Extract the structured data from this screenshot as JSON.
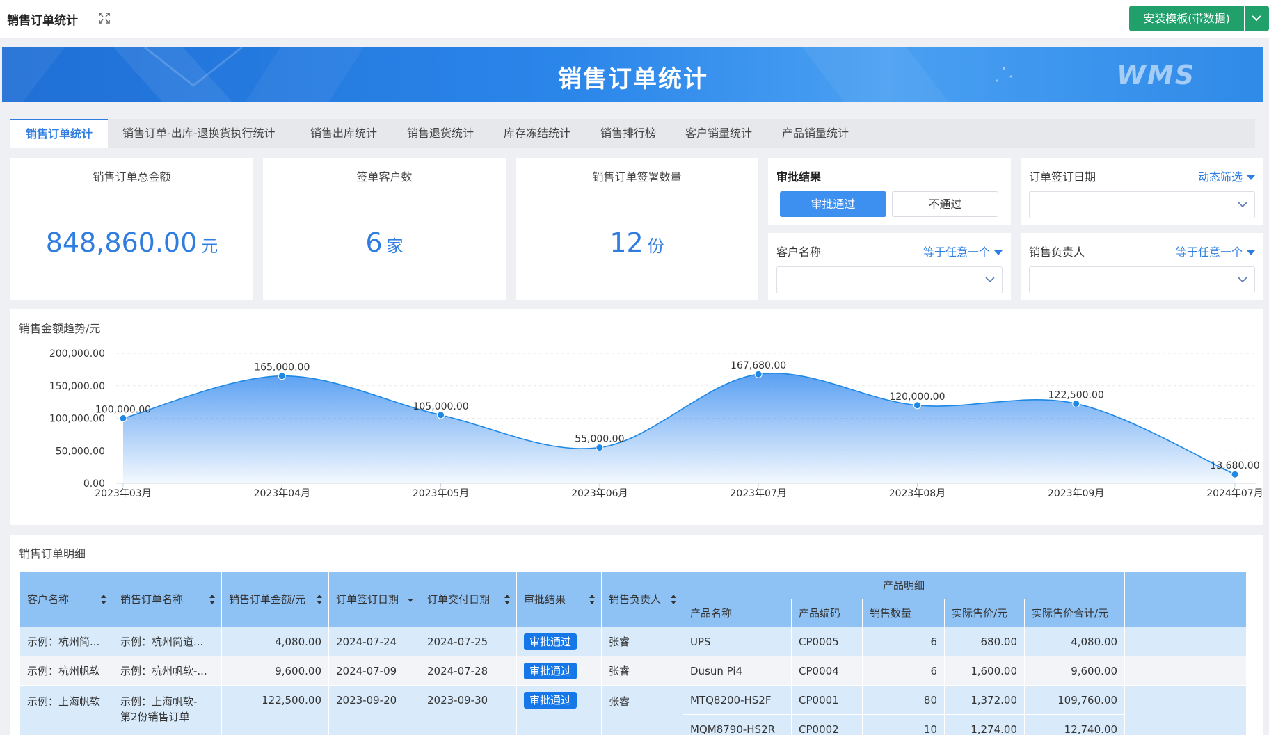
{
  "top": {
    "title": "销售订单统计",
    "install_label": "安装模板(带数据)"
  },
  "banner": {
    "title": "销售订单统计",
    "logo": "WMS"
  },
  "tabs": [
    {
      "label": "销售订单统计",
      "active": true
    },
    {
      "label": "销售订单-出库-退换货执行统计"
    },
    {
      "label": "销售出库统计"
    },
    {
      "label": "销售退货统计"
    },
    {
      "label": "库存冻结统计"
    },
    {
      "label": "销售排行榜"
    },
    {
      "label": "客户销量统计"
    },
    {
      "label": "产品销量统计"
    }
  ],
  "kpis": [
    {
      "label": "销售订单总金额",
      "value": "848,860.00",
      "unit": "元"
    },
    {
      "label": "签单客户数",
      "value": "6",
      "unit": "家"
    },
    {
      "label": "销售订单签署数量",
      "value": "12",
      "unit": "份"
    }
  ],
  "filters": {
    "approval": {
      "label": "审批结果",
      "options": [
        "审批通过",
        "不通过"
      ],
      "selected": "审批通过"
    },
    "sign_date": {
      "label": "订单签订日期",
      "mode": "动态筛选"
    },
    "customer": {
      "label": "客户名称",
      "mode": "等于任意一个"
    },
    "owner": {
      "label": "销售负责人",
      "mode": "等于任意一个"
    }
  },
  "chart_data": {
    "type": "area",
    "title": "销售金额趋势/元",
    "categories": [
      "2023年03月",
      "2023年04月",
      "2023年05月",
      "2023年06月",
      "2023年07月",
      "2023年08月",
      "2023年09月",
      "2024年07月"
    ],
    "values": [
      100000,
      165000,
      105000,
      55000,
      167680,
      120000,
      122500,
      13680
    ],
    "value_labels": [
      "100,000.00",
      "165,000.00",
      "105,000.00",
      "55,000.00",
      "167,680.00",
      "120,000.00",
      "122,500.00",
      "13,680.00"
    ],
    "y_ticks": [
      "0.00",
      "50,000.00",
      "100,000.00",
      "150,000.00",
      "200,000.00"
    ],
    "ylim": [
      0,
      200000
    ],
    "grid": true,
    "color": "#1e88e5"
  },
  "table": {
    "title": "销售订单明细",
    "headers": [
      "客户名称",
      "销售订单名称",
      "销售订单金额/元",
      "订单签订日期",
      "订单交付日期",
      "审批结果",
      "销售负责人"
    ],
    "group_header": "产品明细",
    "sub_headers": [
      "产品名称",
      "产品编码",
      "销售数量",
      "实际售价/元",
      "实际售价合计/元"
    ],
    "rows": [
      {
        "customer": "示例：杭州简...",
        "order": "示例：杭州简道...",
        "amount": "4,080.00",
        "sign": "2024-07-24",
        "deliver": "2024-07-25",
        "approval": "审批通过",
        "owner": "张睿",
        "product": "UPS",
        "code": "CP0005",
        "qty": "6",
        "price": "680.00",
        "total": "4,080.00"
      },
      {
        "customer": "示例：杭州帆软",
        "order": "示例：杭州帆软-...",
        "amount": "9,600.00",
        "sign": "2024-07-09",
        "deliver": "2024-07-28",
        "approval": "审批通过",
        "owner": "张睿",
        "product": "Dusun Pi4",
        "code": "CP0004",
        "qty": "6",
        "price": "1,600.00",
        "total": "9,600.00"
      },
      {
        "customer": "示例：上海帆软",
        "order_line1": "示例：上海帆软-",
        "order_line2": "第2份销售订单",
        "amount": "122,500.00",
        "sign": "2023-09-20",
        "deliver": "2023-09-30",
        "approval": "审批通过",
        "owner": "张睿",
        "products": [
          {
            "product": "MTQ8200-HS2F",
            "code": "CP0001",
            "qty": "80",
            "price": "1,372.00",
            "total": "109,760.00"
          },
          {
            "product": "MQM8790-HS2R",
            "code": "CP0002",
            "qty": "10",
            "price": "1,274.00",
            "total": "12,740.00"
          }
        ]
      }
    ]
  }
}
